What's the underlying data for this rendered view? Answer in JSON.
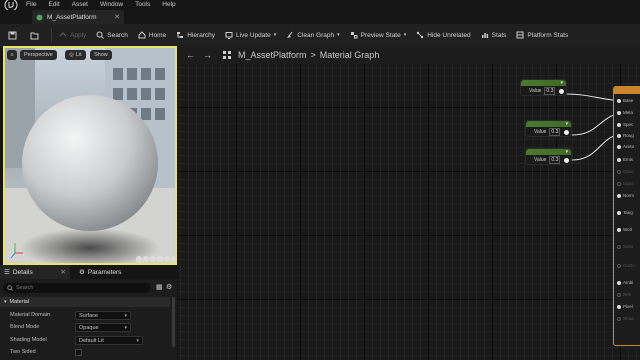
{
  "menu": [
    "File",
    "Edit",
    "Asset",
    "Window",
    "Tools",
    "Help"
  ],
  "tab": {
    "label": "M_AssetPlatform"
  },
  "toolbar": {
    "apply": "Apply",
    "search": "Search",
    "home": "Home",
    "hierarchy": "Hierarchy",
    "live_update": "Live Update",
    "clean_graph": "Clean Graph",
    "preview_state": "Preview State",
    "hide_unrelated": "Hide Unrelated",
    "stats": "Stats",
    "platform_stats": "Platform Stats"
  },
  "viewport": {
    "perspective": "Perspective",
    "lit": "Lit",
    "show": "Show"
  },
  "panels": {
    "details_tab": "Details",
    "parameters_tab": "Parameters",
    "search_placeholder": "Search",
    "section": "Material",
    "properties": [
      {
        "label": "Material Domain",
        "value": "Surface"
      },
      {
        "label": "Blend Mode",
        "value": "Opaque"
      },
      {
        "label": "Shading Model",
        "value": "Default Lit"
      },
      {
        "label": "Two Sided",
        "value": ""
      }
    ]
  },
  "graph": {
    "breadcrumb_asset": "M_AssetPlatform",
    "breadcrumb_sep": ">",
    "breadcrumb_graph": "Material Graph",
    "nodes": [
      {
        "label": "Value",
        "value": "0.3"
      },
      {
        "label": "Value",
        "value": "0.3"
      },
      {
        "label": "Value",
        "value": "0.3"
      }
    ],
    "result_pins": [
      "Base",
      "Meta",
      "Spec",
      "Roug",
      "Aniso",
      "Emis",
      "Opac",
      "Opac",
      "Norm",
      "Tang",
      "Worl",
      "Subs",
      "Custo",
      "Ambi",
      "Refr",
      "Pixel",
      "Shad"
    ]
  },
  "colors": {
    "accent_viewport": "#e6e46a",
    "result_node": "#c9852e",
    "constant_node": "#4b7a2e"
  }
}
